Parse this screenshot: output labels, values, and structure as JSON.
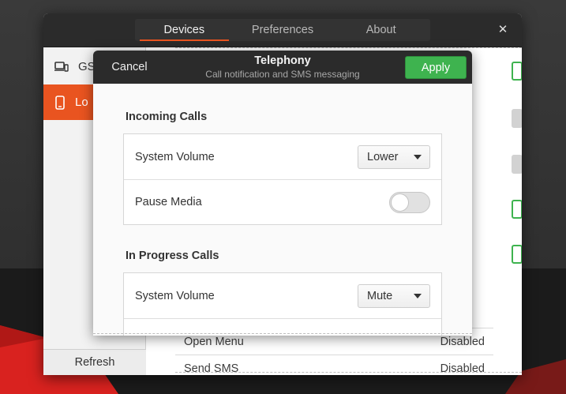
{
  "window": {
    "tabs": [
      {
        "label": "Devices",
        "active": true
      },
      {
        "label": "Preferences",
        "active": false
      },
      {
        "label": "About",
        "active": false
      }
    ],
    "close_glyph": "✕"
  },
  "sidebar": {
    "items": [
      {
        "label": "GS",
        "icon": "laptop-phone-icon",
        "selected": false
      },
      {
        "label": "Lo",
        "icon": "smartphone-icon",
        "selected": true
      }
    ],
    "refresh_label": "Refresh"
  },
  "background_list": {
    "rows": [
      {
        "label": "Open Menu",
        "value": "Disabled"
      },
      {
        "label": "Send SMS",
        "value": "Disabled"
      }
    ]
  },
  "dialog": {
    "cancel_label": "Cancel",
    "title": "Telephony",
    "subtitle": "Call notification and SMS messaging",
    "apply_label": "Apply",
    "sections": [
      {
        "title": "Incoming Calls",
        "rows": [
          {
            "label": "System Volume",
            "type": "combo",
            "value": "Lower"
          },
          {
            "label": "Pause Media",
            "type": "switch",
            "on": false
          }
        ]
      },
      {
        "title": "In Progress Calls",
        "rows": [
          {
            "label": "System Volume",
            "type": "combo",
            "value": "Mute"
          },
          {
            "label": "",
            "type": "switch",
            "on": true
          }
        ]
      }
    ]
  },
  "colors": {
    "accent": "#e95420",
    "apply_green": "#3eb34f",
    "headerbar": "#2b2b2b"
  }
}
